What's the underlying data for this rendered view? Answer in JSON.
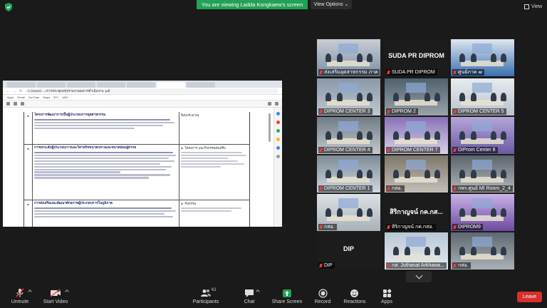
{
  "banner": {
    "text": "You are viewing Ladda Kongkaew's screen"
  },
  "view_options": {
    "label": "View Options ⌄"
  },
  "view_button": {
    "label": "View"
  },
  "shared_screen": {
    "url": "C:/Users/...../การประชุม/สรุปรายงานผลการดำเนินงาน .pdf",
    "bookmarks": [
      "Apps",
      "Gmail",
      "YouTube",
      "Maps",
      "ข่าว",
      "แปล"
    ],
    "rows": [
      {
        "num": "๑",
        "title": "โครงการพัฒนาการเป็นผู้ประกอบการอุตสาหกรรม",
        "right": "ปีงบประมาณ"
      },
      {
        "num": "๒",
        "title": "การยกระดับผู้ประกอบการและวิสาหกิจขนาดกลางและขนาดย่อมสู่สากล",
        "right": "๑. โครงการ และกิจกรรมส่งเสริม"
      },
      {
        "num": "๓",
        "title": "การส่งเสริมและพัฒนาศักยภาพผู้ประกอบการในภูมิภาค",
        "right": "๑. กิจกรรม"
      }
    ]
  },
  "participants_gallery": [
    {
      "name": "ส่งเสริมอุตสาหกรรม ภาค ๓",
      "muted": true,
      "active": true,
      "kind": "video"
    },
    {
      "name": "SUDA PR DIPROM",
      "muted": true,
      "kind": "text",
      "big": "SUDA PR DIPROM"
    },
    {
      "name": "ศูนย์ภาค ๗",
      "muted": true,
      "kind": "video"
    },
    {
      "name": "DIPROM CENTER 3",
      "muted": true,
      "kind": "video"
    },
    {
      "name": "DIPROM 2",
      "muted": true,
      "kind": "video"
    },
    {
      "name": "DIPROM CENTER 5",
      "muted": true,
      "kind": "video"
    },
    {
      "name": "DIPROM CENTER 4",
      "muted": true,
      "kind": "video"
    },
    {
      "name": "DIPROM CENTER 7",
      "muted": true,
      "kind": "video"
    },
    {
      "name": "DIProm Center 8",
      "muted": true,
      "kind": "video"
    },
    {
      "name": "DIPROM CENTER 1",
      "muted": true,
      "kind": "video"
    },
    {
      "name": "กสอ.",
      "muted": true,
      "kind": "video"
    },
    {
      "name": "กพร.ศูนย์ MI Room_2_4",
      "muted": true,
      "kind": "video"
    },
    {
      "name": "กสอ.",
      "muted": true,
      "kind": "video"
    },
    {
      "name": "สิริกาญจน์ กค.กสอ.",
      "muted": true,
      "kind": "text",
      "big": "สิริกาญจน์ กค.กส..."
    },
    {
      "name": "DIPROM9",
      "muted": true,
      "kind": "video"
    },
    {
      "name": "DIP",
      "muted": true,
      "kind": "text",
      "big": "DIP"
    },
    {
      "name": "กส. Juthanat Arkhawa...",
      "muted": true,
      "kind": "video"
    },
    {
      "name": "กสอ.",
      "muted": true,
      "kind": "video"
    }
  ],
  "toolbar": {
    "unmute": "Unmute",
    "start_video": "Start Video",
    "participants": "Participants",
    "participants_count": "61",
    "chat": "Chat",
    "share_screen": "Share Screen",
    "record": "Record",
    "reactions": "Reactions",
    "apps": "Apps",
    "leave": "Leave"
  },
  "colors": {
    "banner": "#23a155",
    "leave": "#d5312d",
    "active_speaker": "#d8e84a",
    "share_green": "#23a155",
    "muted_red": "#ff3b3b"
  }
}
